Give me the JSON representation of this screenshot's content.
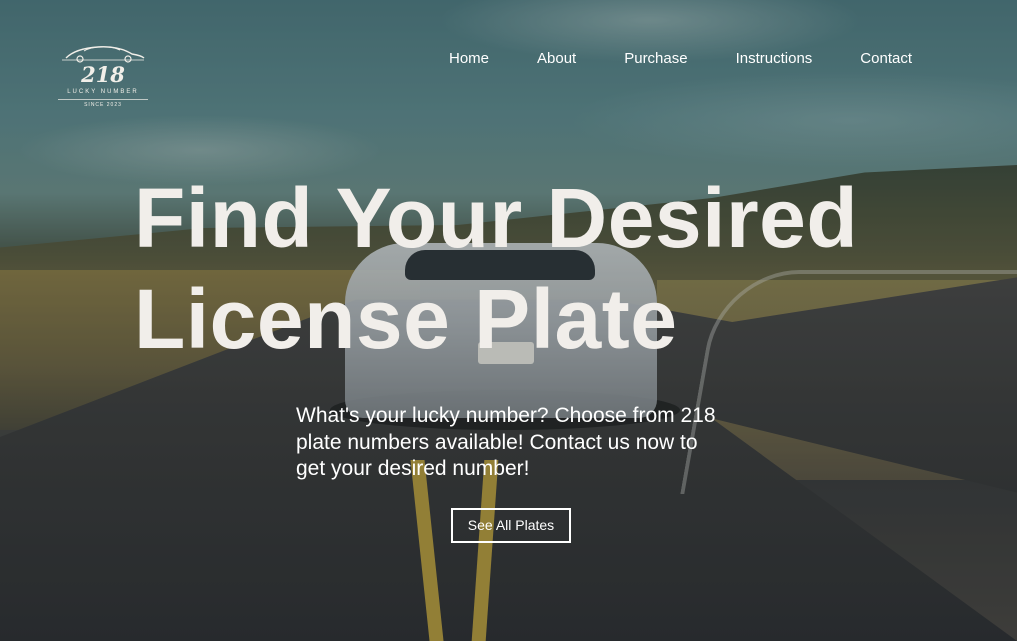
{
  "logo": {
    "number": "218",
    "subtitle": "LUCKY NUMBER",
    "since": "SINCE 2023",
    "icon": "car-silhouette-icon"
  },
  "nav": {
    "items": [
      {
        "label": "Home"
      },
      {
        "label": "About"
      },
      {
        "label": "Purchase"
      },
      {
        "label": "Instructions"
      },
      {
        "label": "Contact"
      }
    ]
  },
  "hero": {
    "headline_line1": "Find Your Desired",
    "headline_line2": "License Plate",
    "tagline": "What's your lucky number? Choose from 218 plate numbers available! Contact us now to get your desired number!",
    "cta_label": "See All Plates"
  },
  "colors": {
    "text_primary": "#ffffff",
    "headline": "#f1eeea"
  }
}
